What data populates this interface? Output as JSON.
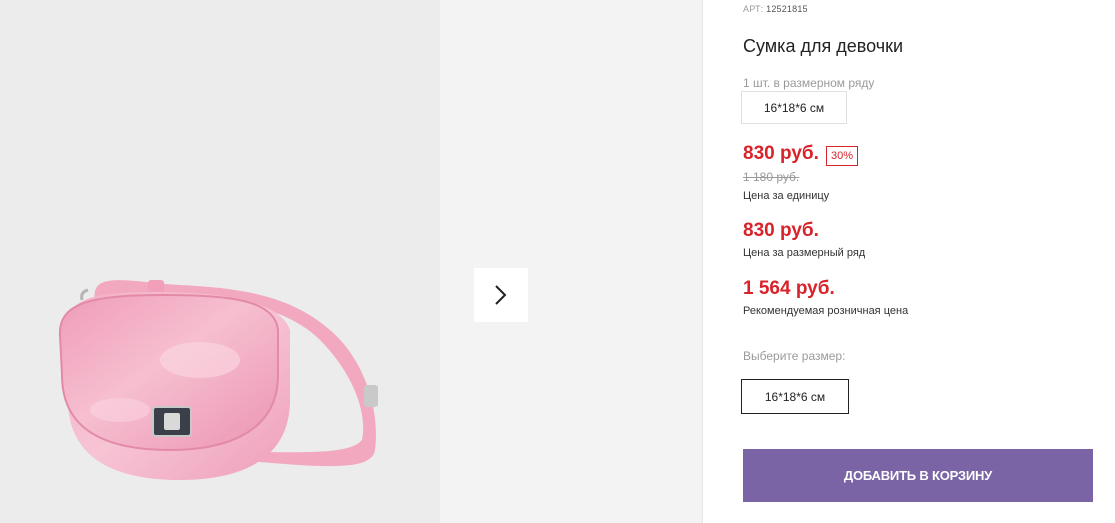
{
  "product": {
    "art_label": "АРТ:",
    "art_number": "12521815",
    "title": "Сумка для девочки",
    "size_row_note": "1 шт. в размерном ряду",
    "size_row_value": "16*18*6 см",
    "price": "830 руб.",
    "discount": "30%",
    "old_price": "1 180 руб.",
    "price_unit_caption": "Цена за единицу",
    "row_price": "830 руб.",
    "row_price_caption": "Цена за размерный ряд",
    "retail_price": "1 564 руб.",
    "retail_price_caption": "Рекомендуемая розничная цена",
    "choose_size_label": "Выберите размер:",
    "size_option": "16*18*6 см",
    "add_to_cart": "ДОБАВИТЬ В КОРЗИНУ"
  },
  "colors": {
    "accent": "#7a64a6",
    "price": "#d8232a",
    "bag": "#f0a3bd"
  },
  "gallery": {
    "next_icon": "chevron-right-icon",
    "image": "pink-crossbody-bag"
  }
}
